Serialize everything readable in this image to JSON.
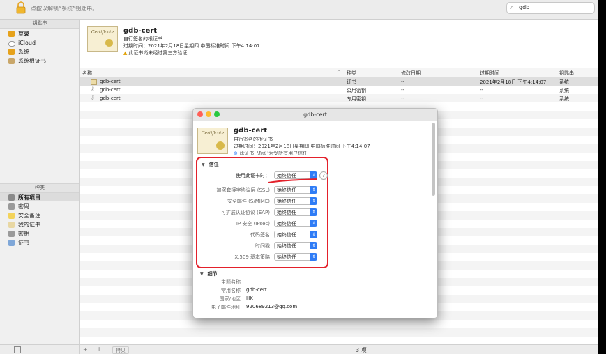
{
  "toolbar": {
    "lock_text": "点按以解锁“系统”钥匙串。",
    "search_value": "gdb"
  },
  "sidebar": {
    "keychains_header": "钥匙串",
    "keychains": [
      "登录",
      "iCloud",
      "系统",
      "系统根证书"
    ],
    "categories_header": "种类",
    "categories": [
      "所有项目",
      "密码",
      "安全备注",
      "我的证书",
      "密钥",
      "证书"
    ]
  },
  "header": {
    "name": "gdb-cert",
    "subtitle": "自行签名的根证书",
    "expires": "过期时间：2021年2月18日星期四 中国标准时间 下午4:14:07",
    "warning": "此证书尚未经过第三方验证"
  },
  "table": {
    "columns": [
      "名称",
      "种类",
      "修改日期",
      "过期时间",
      "钥匙串"
    ],
    "rows": [
      {
        "name": "gdb-cert",
        "kind": "证书",
        "modified": "--",
        "expires": "2021年2月18日 下午4:14:07",
        "keychain": "系统"
      },
      {
        "name": "gdb-cert",
        "kind": "公用密钥",
        "modified": "--",
        "expires": "--",
        "keychain": "系统"
      },
      {
        "name": "gdb-cert",
        "kind": "专用密钥",
        "modified": "--",
        "expires": "--",
        "keychain": "系统"
      }
    ]
  },
  "footer": {
    "add": "+",
    "info": "i",
    "copy": "拷贝",
    "count": "3 项"
  },
  "dialog": {
    "title": "gdb-cert",
    "name": "gdb-cert",
    "subtitle": "自行签名的根证书",
    "expires": "过期时间：2021年2月18日星期四 中国标准时间 下午4:14:07",
    "warning": "此证书已标记为受所有用户信任",
    "trust_section": "信任",
    "when_using_label": "使用此证书时：",
    "when_using_value": "始终信任",
    "trust_rows": [
      {
        "label": "加密套接字协议层 (SSL)",
        "value": "始终信任"
      },
      {
        "label": "安全邮件 (S/MIME)",
        "value": "始终信任"
      },
      {
        "label": "可扩展认证协议 (EAP)",
        "value": "始终信任"
      },
      {
        "label": "IP 安全 (IPsec)",
        "value": "始终信任"
      },
      {
        "label": "代码签名",
        "value": "始终信任"
      },
      {
        "label": "时间戳",
        "value": "始终信任"
      },
      {
        "label": "X.509 基本策略",
        "value": "始终信任"
      }
    ],
    "details_section": "细节",
    "details": [
      {
        "label": "主题名称",
        "value": ""
      },
      {
        "label": "常用名称",
        "value": "gdb-cert"
      },
      {
        "label": "国家/地区",
        "value": "HK"
      },
      {
        "label": "电子邮件地址",
        "value": "920689213@qq.com"
      }
    ]
  },
  "colors": {
    "highlight_red": "#e3212b",
    "select_blue": "#2f7cf6"
  }
}
